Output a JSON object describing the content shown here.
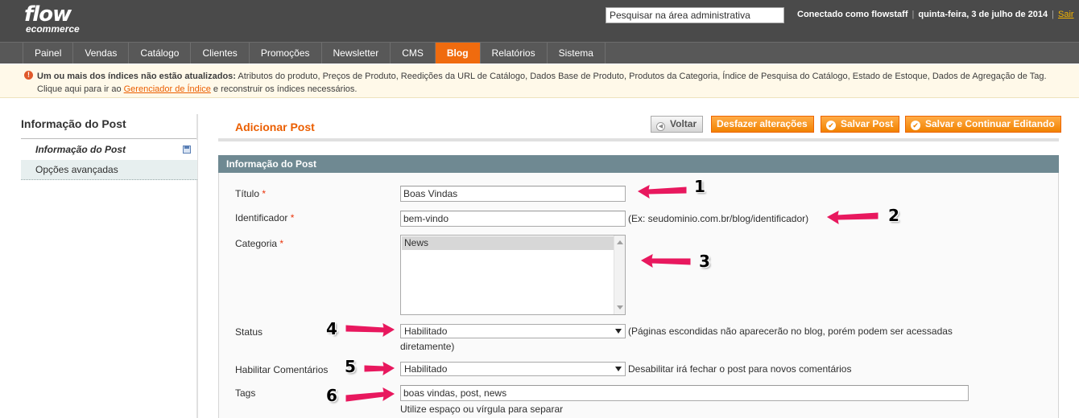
{
  "header": {
    "logo_line1": "flow",
    "logo_line2": "ecommerce",
    "search_value": "Pesquisar na área administrativa",
    "logged_as": "Conectado como flowstaff",
    "date": "quinta-feira, 3 de julho de 2014",
    "logout": "Sair"
  },
  "nav": {
    "items": [
      {
        "label": "Painel"
      },
      {
        "label": "Vendas"
      },
      {
        "label": "Catálogo"
      },
      {
        "label": "Clientes"
      },
      {
        "label": "Promoções"
      },
      {
        "label": "Newsletter"
      },
      {
        "label": "CMS"
      },
      {
        "label": "Blog"
      },
      {
        "label": "Relatórios"
      },
      {
        "label": "Sistema"
      }
    ],
    "active": "Blog"
  },
  "notice": {
    "icon": "warning-icon",
    "bold": "Um ou mais dos índices não estão atualizados:",
    "text": " Atributos do produto, Preços de Produto, Reedições da URL de Catálogo, Dados Base de Produto, Produtos da Categoria, Índice de Pesquisa do Catálogo, Estado de Estoque, Dados de Agregação de Tag.",
    "line2_prefix": "Clique aqui para ir ao ",
    "link": "Gerenciador de Índice",
    "line2_suffix": " e reconstruir os índices necessários."
  },
  "sidebar": {
    "title": "Informação do Post",
    "tabs": [
      {
        "label": "Informação do Post"
      },
      {
        "label": "Opções avançadas"
      }
    ]
  },
  "content": {
    "title": "Adicionar Post",
    "buttons": {
      "back": "Voltar",
      "reset": "Desfazer alterações",
      "save": "Salvar Post",
      "save_continue": "Salvar e Continuar Editando"
    },
    "fieldset_title": "Informação do Post"
  },
  "form": {
    "title": {
      "label": "Título",
      "required": "*",
      "value": "Boas Vindas"
    },
    "identifier": {
      "label": "Identificador",
      "required": "*",
      "value": "bem-vindo",
      "note": "(Ex: seudominio.com.br/blog/identificador)"
    },
    "category": {
      "label": "Categoria",
      "required": "*",
      "options": [
        "News"
      ]
    },
    "status": {
      "label": "Status",
      "value": "Habilitado",
      "note_line1": "(Páginas escondidas não aparecerão no blog, porém podem ser acessadas",
      "note_line2": "diretamente)"
    },
    "comments": {
      "label": "Habilitar Comentários",
      "value": "Habilitado",
      "note": "Desabilitar irá fechar o post para novos comentários"
    },
    "tags": {
      "label": "Tags",
      "value": "boas vindas, post, news",
      "note": "Utilize espaço ou vírgula para separar"
    }
  },
  "annotations": {
    "numbers": [
      "1",
      "2",
      "3",
      "4",
      "5",
      "6"
    ],
    "arrow_color": "#e8185e"
  },
  "colors": {
    "accent": "#eb5e00",
    "header_bg": "#4a4a4a",
    "nav_bg": "#585858",
    "nav_active": "#f06b0e",
    "fieldset_head": "#6f8992"
  }
}
